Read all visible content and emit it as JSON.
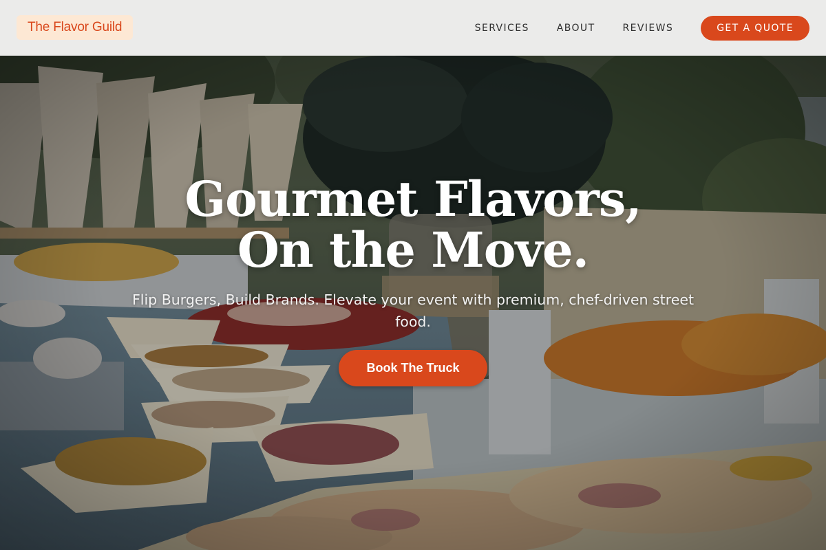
{
  "brand": {
    "name": "The Flavor Guild",
    "accent_color": "#d9481c",
    "logo_bg_color": "#fde8d4"
  },
  "nav": {
    "items": [
      {
        "label": "SERVICES"
      },
      {
        "label": "ABOUT"
      },
      {
        "label": "REVIEWS"
      }
    ],
    "cta_label": "GET A QUOTE"
  },
  "hero": {
    "title_line1": "Gourmet Flavors,",
    "title_line2": "On the Move.",
    "subtitle": "Flip Burgers, Build Brands. Elevate your event with premium, chef-driven street food.",
    "cta_label": "Book The Truck",
    "background_image": "catering buffet table with snacks, paper cones, and flower vase outdoors"
  }
}
